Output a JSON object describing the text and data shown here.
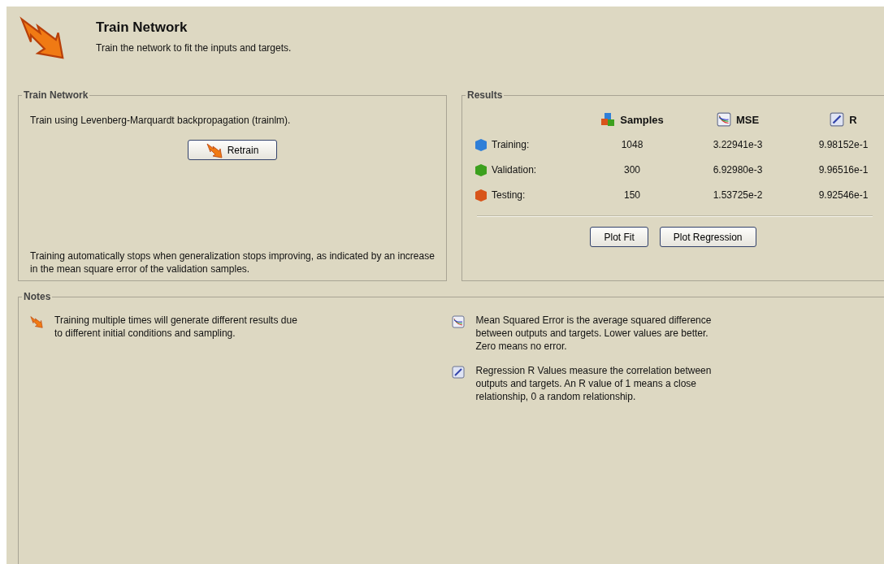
{
  "header": {
    "title": "Train Network",
    "subtitle": "Train the network to fit the inputs and targets."
  },
  "train_panel": {
    "title": "Train Network",
    "method": "Train using Levenberg-Marquardt backpropagation (trainlm).",
    "button": "Retrain",
    "note": "Training automatically stops when generalization stops improving, as indicated by an increase in the mean square error of the validation samples."
  },
  "results": {
    "title": "Results",
    "columns": [
      {
        "kind": "samples",
        "label": "Samples"
      },
      {
        "kind": "mse",
        "label": "MSE"
      },
      {
        "kind": "regression",
        "label": "R"
      }
    ],
    "rows": [
      {
        "label": "Training:",
        "color": "#2f7fd8",
        "values": [
          "1048",
          "3.22941e-3",
          "9.98152e-1"
        ]
      },
      {
        "label": "Validation:",
        "color": "#3ca01e",
        "values": [
          "300",
          "6.92980e-3",
          "9.96516e-1"
        ]
      },
      {
        "label": "Testing:",
        "color": "#d8541a",
        "values": [
          "150",
          "1.53725e-2",
          "9.92546e-1"
        ]
      }
    ],
    "buttons": [
      "Plot Fit",
      "Plot Regression"
    ]
  },
  "notes": {
    "title": "Notes",
    "columns": [
      [
        {
          "kind": "arrow",
          "text": "Training multiple times will generate different results due to different initial conditions and sampling."
        }
      ],
      [
        {
          "kind": "mse",
          "text": "Mean Squared Error is the average squared difference between outputs and targets. Lower values are better. Zero means no error."
        },
        {
          "kind": "regression",
          "text": "Regression R Values measure the correlation between outputs and targets. An R value of 1 means a close relationship, 0 a random relationship."
        }
      ]
    ]
  }
}
